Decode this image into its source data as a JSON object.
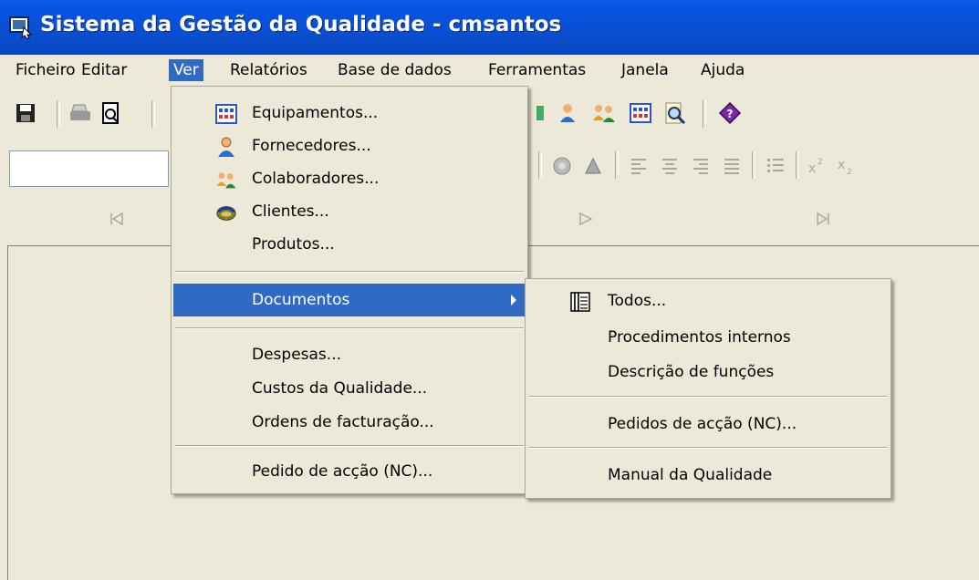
{
  "window": {
    "title": "Sistema da Gestão da Qualidade - cmsantos"
  },
  "menubar": {
    "items": [
      "Ficheiro",
      "Editar",
      "Ver",
      "Relatórios",
      "Base de dados",
      "Ferramentas",
      "Janela",
      "Ajuda"
    ],
    "active": "Ver"
  },
  "ver_menu": {
    "items": [
      {
        "label": "Equipamentos...",
        "icon": "grid-icon"
      },
      {
        "label": "Fornecedores...",
        "icon": "person-icon"
      },
      {
        "label": "Colaboradores...",
        "icon": "people-icon"
      },
      {
        "label": "Clientes...",
        "icon": "handshake-icon"
      },
      {
        "label": "Produtos..."
      },
      {
        "label": "Documentos",
        "submenu": true,
        "highlighted": true
      },
      {
        "label": "Despesas..."
      },
      {
        "label": "Custos da Qualidade..."
      },
      {
        "label": "Ordens de facturação..."
      },
      {
        "label": "Pedido de acção (NC)..."
      }
    ]
  },
  "documentos_submenu": {
    "items": [
      {
        "label": "Todos...",
        "icon": "documents-icon"
      },
      {
        "label": "Procedimentos internos"
      },
      {
        "label": "Descrição de funções"
      },
      {
        "label": "Pedidos de acção (NC)..."
      },
      {
        "label": "Manual da Qualidade"
      }
    ]
  },
  "colors": {
    "titlebar": "#0553e3",
    "highlight": "#316ac5",
    "face": "#ece9d8"
  }
}
